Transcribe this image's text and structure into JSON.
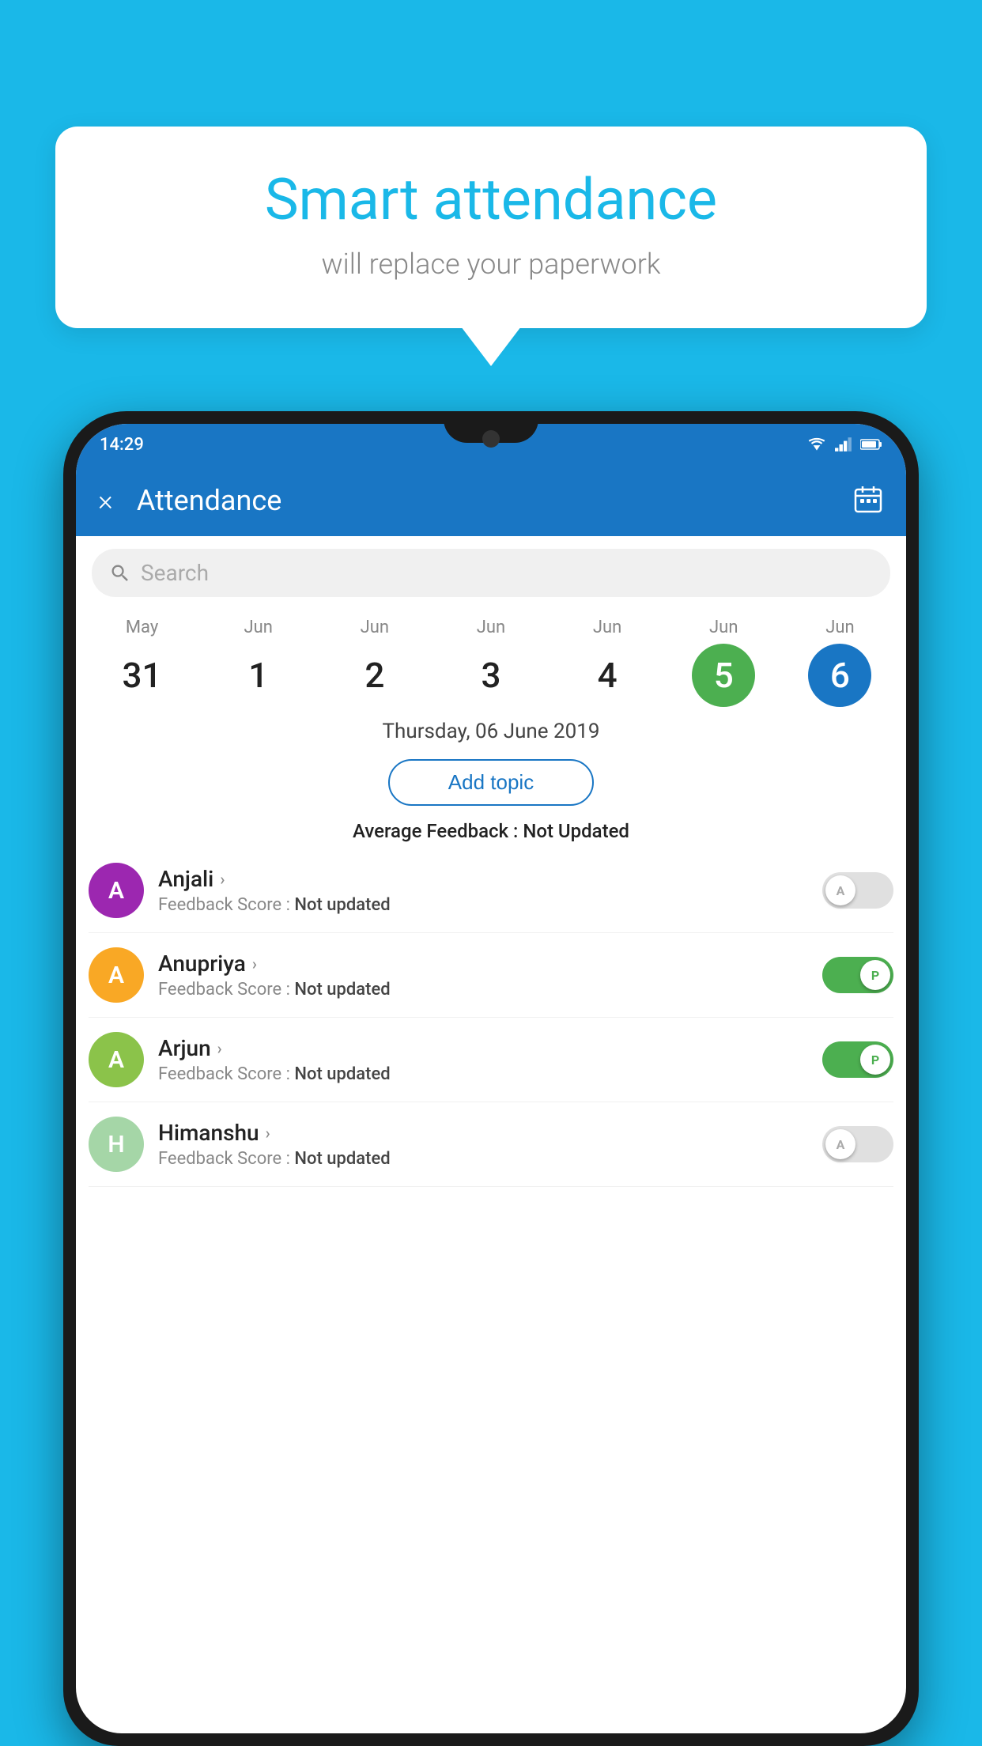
{
  "background_color": "#1ab8e8",
  "bubble": {
    "title": "Smart attendance",
    "subtitle": "will replace your paperwork"
  },
  "phone": {
    "status_bar": {
      "time": "14:29"
    },
    "app_bar": {
      "title": "Attendance",
      "close_label": "×",
      "calendar_label": "📅"
    },
    "search": {
      "placeholder": "Search"
    },
    "calendar": {
      "days": [
        {
          "month": "May",
          "date": "31",
          "style": "normal"
        },
        {
          "month": "Jun",
          "date": "1",
          "style": "normal"
        },
        {
          "month": "Jun",
          "date": "2",
          "style": "normal"
        },
        {
          "month": "Jun",
          "date": "3",
          "style": "normal"
        },
        {
          "month": "Jun",
          "date": "4",
          "style": "normal"
        },
        {
          "month": "Jun",
          "date": "5",
          "style": "green"
        },
        {
          "month": "Jun",
          "date": "6",
          "style": "blue"
        }
      ]
    },
    "selected_date": "Thursday, 06 June 2019",
    "add_topic_label": "Add topic",
    "avg_feedback_label": "Average Feedback :",
    "avg_feedback_value": "Not Updated",
    "students": [
      {
        "name": "Anjali",
        "initial": "A",
        "avatar_color": "#9c27b0",
        "feedback_label": "Feedback Score :",
        "feedback_value": "Not updated",
        "toggle_state": "off",
        "toggle_letter": "A"
      },
      {
        "name": "Anupriya",
        "initial": "A",
        "avatar_color": "#f9a825",
        "feedback_label": "Feedback Score :",
        "feedback_value": "Not updated",
        "toggle_state": "on",
        "toggle_letter": "P"
      },
      {
        "name": "Arjun",
        "initial": "A",
        "avatar_color": "#8bc34a",
        "feedback_label": "Feedback Score :",
        "feedback_value": "Not updated",
        "toggle_state": "on",
        "toggle_letter": "P"
      },
      {
        "name": "Himanshu",
        "initial": "H",
        "avatar_color": "#a5d6a7",
        "feedback_label": "Feedback Score :",
        "feedback_value": "Not updated",
        "toggle_state": "off",
        "toggle_letter": "A"
      }
    ]
  }
}
